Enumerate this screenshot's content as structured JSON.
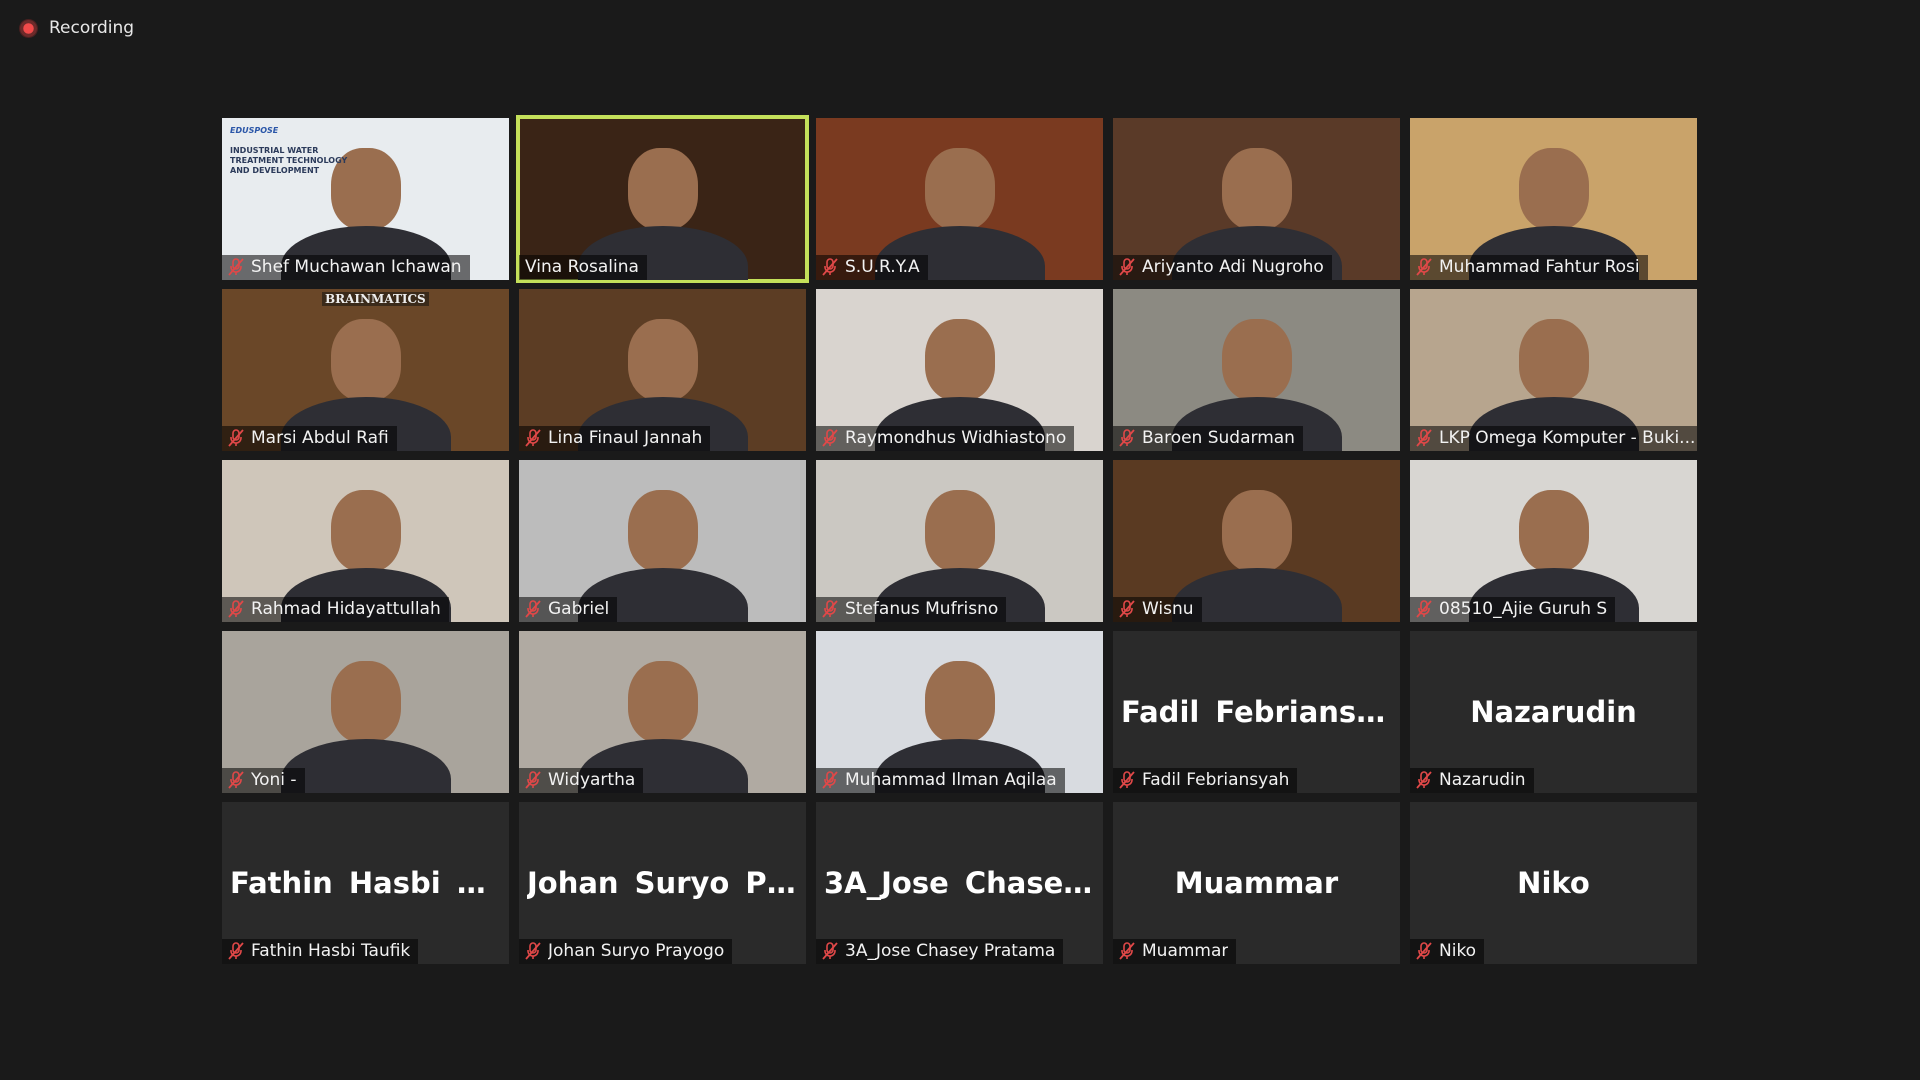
{
  "recording": {
    "label": "Recording",
    "color": "#f14a4a"
  },
  "active_speaker_color": "#c4e05a",
  "participants": [
    {
      "name": "Shef Muchawan Ichawan",
      "video": true,
      "bg": "#e8ecef",
      "poster_text": "INDUSTRIAL WATER TREATMENT TECHNOLOGY AND DEVELOPMENT",
      "poster_brand": "EDUSPOSE"
    },
    {
      "name": "Vina Rosalina",
      "video": true,
      "bg": "#3a2416",
      "active": true
    },
    {
      "name": "S.U.R.Y.A",
      "video": true,
      "bg": "#7a3a20"
    },
    {
      "name": "Ariyanto Adi Nugroho",
      "video": true,
      "bg": "#5a3a28"
    },
    {
      "name": "Muhammad Fahtur Rosi",
      "video": true,
      "bg": "#c9a36a"
    },
    {
      "name": "Marsi Abdul Rafi",
      "video": true,
      "bg": "#6a4728",
      "wall_text": "BRAINMATICS"
    },
    {
      "name": "Lina Finaul Jannah",
      "video": true,
      "bg": "#5c3d24"
    },
    {
      "name": "Raymondhus Widhiastono",
      "video": true,
      "bg": "#d9d4cf"
    },
    {
      "name": "Baroen Sudarman",
      "video": true,
      "bg": "#8c8a82"
    },
    {
      "name": "LKP Omega Komputer - Buki...",
      "video": true,
      "bg": "#b7a58e"
    },
    {
      "name": "Rahmad Hidayattullah",
      "video": true,
      "bg": "#cfc6ba"
    },
    {
      "name": "Gabriel",
      "video": true,
      "bg": "#bcbcbc"
    },
    {
      "name": "Stefanus Mufrisno",
      "video": true,
      "bg": "#cbc8c2"
    },
    {
      "name": "Wisnu",
      "video": true,
      "bg": "#5a3a22"
    },
    {
      "name": "08510_Ajie Guruh S",
      "video": true,
      "bg": "#d8d6d2"
    },
    {
      "name": "Yoni -",
      "video": true,
      "bg": "#a9a49c"
    },
    {
      "name": "Widyartha",
      "video": true,
      "bg": "#b0aaa2"
    },
    {
      "name": "Muhammad Ilman Aqilaa",
      "video": true,
      "bg": "#d8dbe0"
    },
    {
      "name": "Fadil Febriansyah",
      "video": false,
      "display": "Fadil Febriansyah"
    },
    {
      "name": "Nazarudin",
      "video": false,
      "display": "Nazarudin"
    },
    {
      "name": "Fathin Hasbi Taufik",
      "video": false,
      "display": "Fathin Hasbi Ta..."
    },
    {
      "name": "Johan Suryo Prayogo",
      "video": false,
      "display": "Johan Suryo Pr..."
    },
    {
      "name": "3A_Jose Chasey Pratama",
      "video": false,
      "display": "3A_Jose Chasey..."
    },
    {
      "name": "Muammar",
      "video": false,
      "display": "Muammar"
    },
    {
      "name": "Niko",
      "video": false,
      "display": "Niko"
    }
  ]
}
